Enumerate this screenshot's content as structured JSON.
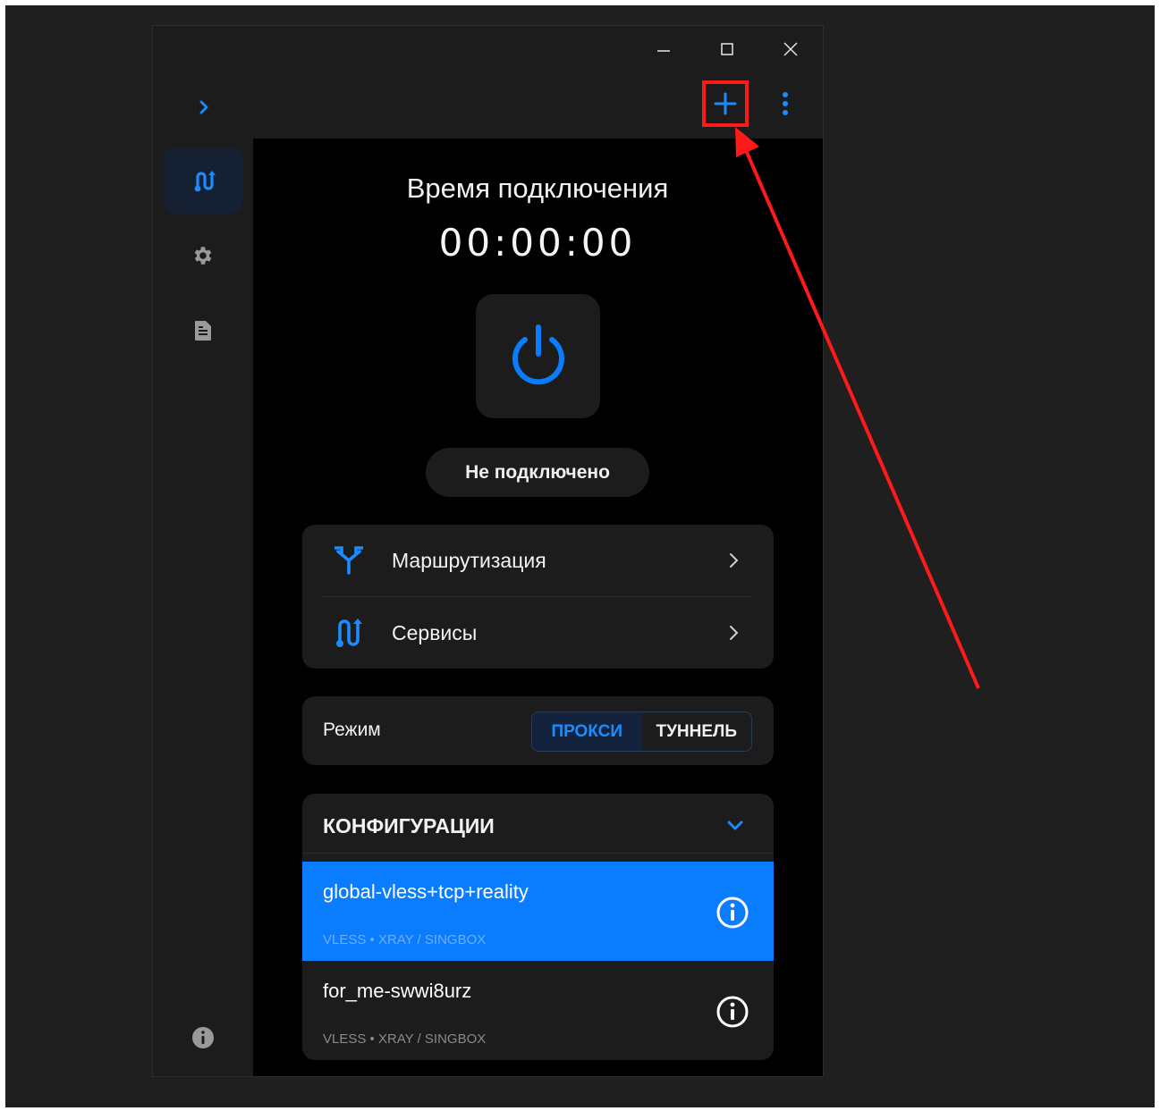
{
  "content": {
    "timer_title": "Время подключения",
    "timer_value": "00:00:00",
    "status": "Не подключено"
  },
  "menu": {
    "routing_label": "Маршрутизация",
    "services_label": "Сервисы"
  },
  "mode": {
    "label": "Режим",
    "options": [
      "ПРОКСИ",
      "ТУННЕЛЬ"
    ],
    "selected": "ПРОКСИ"
  },
  "configs": {
    "header": "КОНФИГУРАЦИИ",
    "items": [
      {
        "name": "global-vless+tcp+reality",
        "meta": "VLESS • XRAY / SINGBOX",
        "selected": true
      },
      {
        "name": "for_me-swwi8urz",
        "meta": "VLESS • XRAY / SINGBOX",
        "selected": false
      }
    ]
  },
  "icons": {
    "window_controls": [
      "minimize-icon",
      "maximize-icon",
      "close-icon"
    ],
    "toolbar": [
      "chevron-right-icon",
      "plus-icon",
      "more-vertical-icon"
    ],
    "sidebar": [
      "connections-icon",
      "gear-icon",
      "document-icon",
      "info-icon"
    ],
    "content": [
      "power-icon",
      "routing-icon",
      "services-icon",
      "chevron-down-icon",
      "info-circle-icon"
    ]
  },
  "colors": {
    "accent": "#0a7dff",
    "annotation": "#ff1a1a",
    "content_bg": "#000000",
    "card_bg": "#1c1c1c"
  }
}
